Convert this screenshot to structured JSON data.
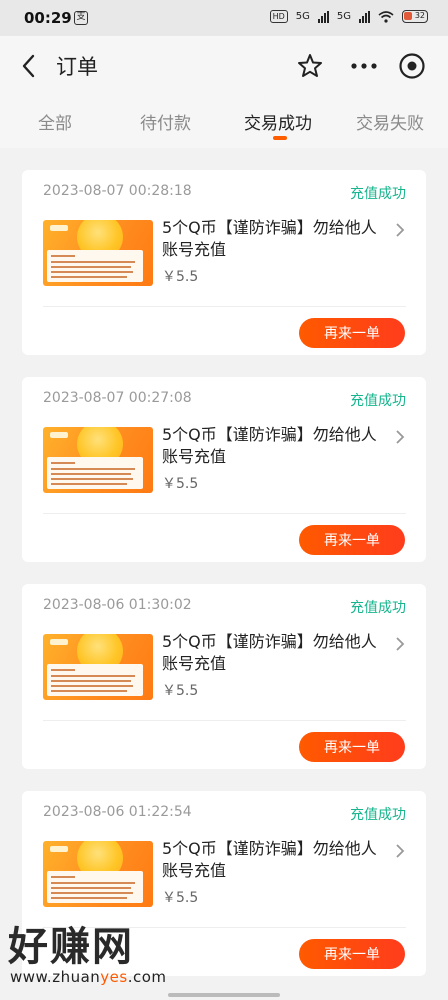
{
  "status_bar": {
    "time": "00:29",
    "app_icon_glyph": "支",
    "hd": "HD",
    "net1": "5G",
    "net2": "5G",
    "battery": "32"
  },
  "nav": {
    "title": "订单",
    "icons": [
      "back-icon",
      "star-icon",
      "more-icon",
      "target-icon"
    ]
  },
  "tabs": [
    {
      "label": "全部"
    },
    {
      "label": "待付款"
    },
    {
      "label": "交易成功"
    },
    {
      "label": "交易失败"
    }
  ],
  "active_tab": "交易成功",
  "orders": [
    {
      "date": "2023-08-07 00:28:18",
      "status": "充值成功",
      "name": "5个Q币【谨防诈骗】勿给他人账号充值",
      "price": "￥5.5",
      "button": "再来一单"
    },
    {
      "date": "2023-08-07 00:27:08",
      "status": "充值成功",
      "name": "5个Q币【谨防诈骗】勿给他人账号充值",
      "price": "￥5.5",
      "button": "再来一单"
    },
    {
      "date": "2023-08-06 01:30:02",
      "status": "充值成功",
      "name": "5个Q币【谨防诈骗】勿给他人账号充值",
      "price": "￥5.5",
      "button": "再来一单"
    },
    {
      "date": "2023-08-06 01:22:54",
      "status": "充值成功",
      "name": "5个Q币【谨防诈骗】勿给他人账号充值",
      "price": "￥5.5",
      "button": "再来一单"
    }
  ],
  "watermark": {
    "big": "好赚网",
    "url_a": "www.zhuan",
    "url_b": "yes",
    "url_c": ".com"
  },
  "colors": {
    "accent": "#ff5e00",
    "success": "#16b58e",
    "button": "#ff4a10"
  }
}
